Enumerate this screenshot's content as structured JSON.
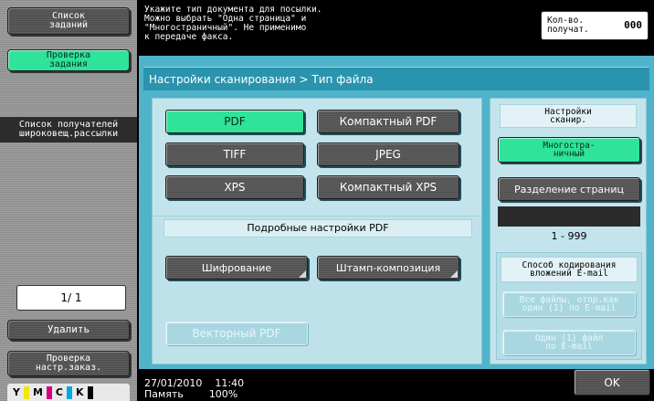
{
  "left_panel": {
    "job_list_label": "Список\nзаданий",
    "job_check_label": "Проверка\nзадания",
    "broadcast_label": "Список получателей\nшироковещ.рассылки",
    "page_counter": "1/  1",
    "delete_label": "Удалить",
    "settings_check_label": "Проверка\nнастр.заказ.",
    "toner": [
      {
        "letter": "Y",
        "color": "#f2e600"
      },
      {
        "letter": "M",
        "color": "#d4007a"
      },
      {
        "letter": "C",
        "color": "#00a7e1"
      },
      {
        "letter": "K",
        "color": "#000000"
      }
    ]
  },
  "message": "Укажите тип документа для посылки.\nМожно выбрать \"Одна страница\" и\n\"Многостраничный\". Не применимо\nк передаче факса.",
  "recipients": {
    "label": "Кол-во.\nполучат.",
    "value": "000"
  },
  "breadcrumb": "Настройки сканирования > Тип файла",
  "file_types": {
    "pdf": "PDF",
    "compact_pdf": "Компактный PDF",
    "tiff": "TIFF",
    "jpeg": "JPEG",
    "xps": "XPS",
    "compact_xps": "Компактный XPS",
    "selected": "PDF"
  },
  "pdf_details": {
    "title": "Подробные настройки PDF",
    "encryption": "Шифрование",
    "stamp": "Штамп-композиция",
    "vector_pdf": "Векторный PDF"
  },
  "scan_settings": {
    "title": "Настройки\nсканир.",
    "multipage": "Многостра-\nничный",
    "page_split": "Разделение страниц",
    "range": "1   -   999"
  },
  "email_encoding": {
    "title": "Способ кодирования\nвложений E-mail",
    "all_files": "Все файлы, отпр.как\nодин (1) по E-mail",
    "one_file": "Один (1) файл\nпо E-mail"
  },
  "footer": {
    "date": "27/01/2010",
    "time": "11:40",
    "memory_label": "Память",
    "memory_value": "100%",
    "ok_label": "OK"
  }
}
